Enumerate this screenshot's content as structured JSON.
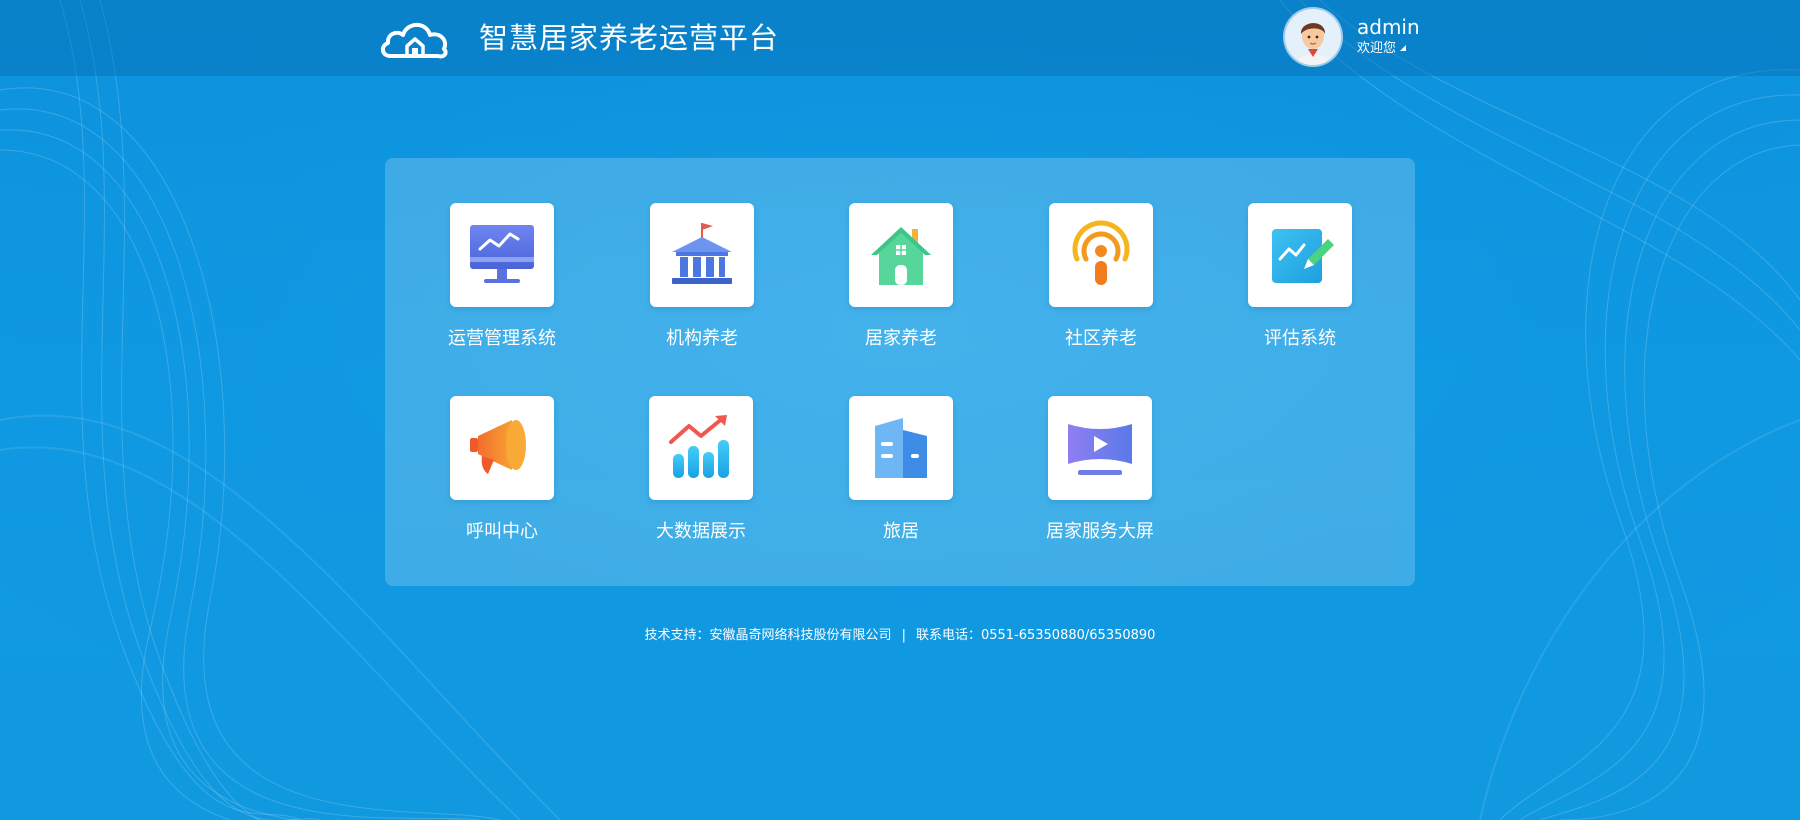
{
  "header": {
    "title": "智慧居家养老运营平台",
    "logo_icon": "cloud-home-icon",
    "user": {
      "name": "admin",
      "welcome": "欢迎您",
      "avatar_icon": "user-avatar-icon"
    }
  },
  "apps": [
    {
      "label": "运营管理系统",
      "icon": "monitor-chart-icon"
    },
    {
      "label": "机构养老",
      "icon": "institution-building-icon"
    },
    {
      "label": "居家养老",
      "icon": "house-icon"
    },
    {
      "label": "社区养老",
      "icon": "broadcast-person-icon"
    },
    {
      "label": "评估系统",
      "icon": "edit-chart-icon"
    },
    {
      "label": "呼叫中心",
      "icon": "megaphone-icon"
    },
    {
      "label": "大数据展示",
      "icon": "bar-trend-icon"
    },
    {
      "label": "旅居",
      "icon": "buildings-icon"
    },
    {
      "label": "居家服务大屏",
      "icon": "video-screen-icon"
    }
  ],
  "footer": {
    "support": "技术支持：安徽晶奇网络科技股份有限公司",
    "separator": "|",
    "phone": "联系电话：0551-65350880/65350890"
  },
  "colors": {
    "background": "#0f9ae3",
    "topbar": "#0a7fc4",
    "panel": "rgba(255,255,255,0.2)"
  }
}
